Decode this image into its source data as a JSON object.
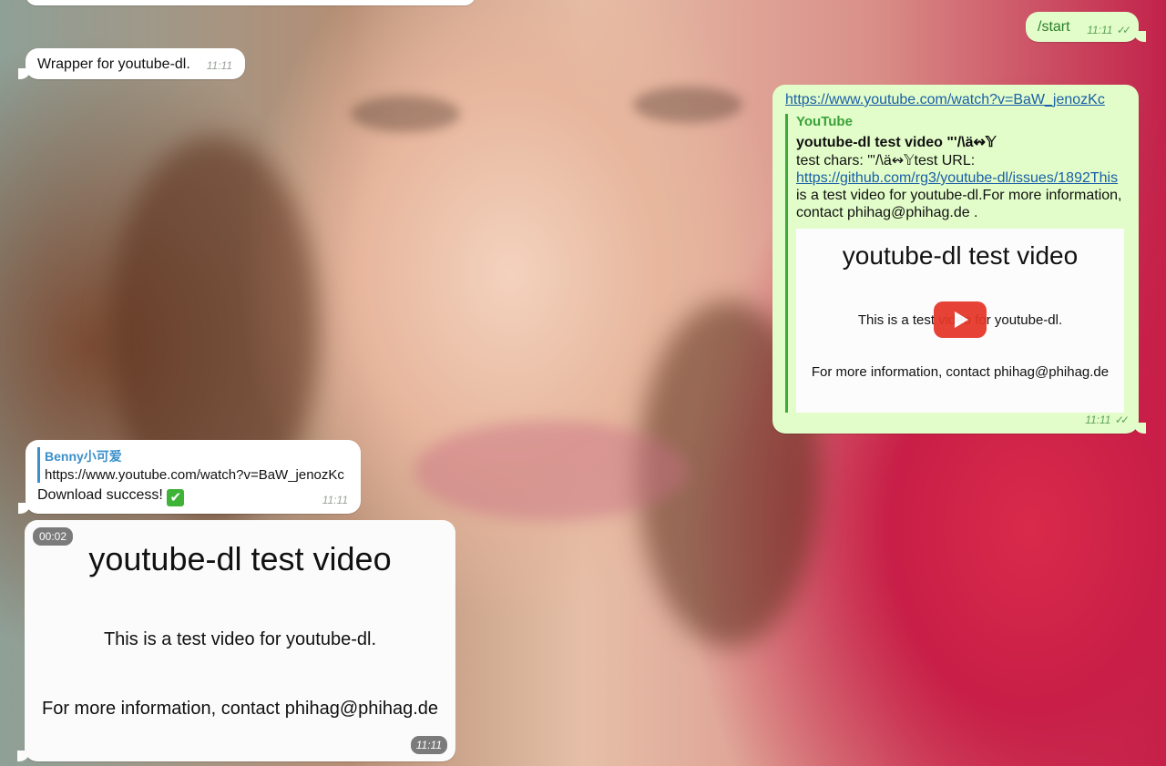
{
  "messages": {
    "wrapper": {
      "text": "Wrapper for youtube-dl.",
      "time": "11:11"
    },
    "start": {
      "text": "/start",
      "time": "11:11",
      "status": "✓✓"
    },
    "link_preview": {
      "url": "https://www.youtube.com/watch?v=BaW_jenozKc",
      "source": "YouTube",
      "title": "youtube-dl test video \"'/\\ä↭𝕐",
      "desc_prefix": "test chars:  \"'/\\ä↭𝕐test URL: ",
      "desc_link": "https://github.com/rg3/youtube-dl/issues/1892This",
      "desc_suffix": " is a test video for youtube-dl.For more information, contact phihag@phihag.de .",
      "preview_title": "youtube-dl test video",
      "preview_line1": "This is a test video for youtube-dl.",
      "preview_line2": "For more information, contact phihag@phihag.de",
      "time": "11:11",
      "status": "✓✓"
    },
    "reply": {
      "reply_to_name": "Benny小可爱",
      "reply_to_text": "https://www.youtube.com/watch?v=BaW_jenozKc",
      "text": "Download success!",
      "emoji": "✔",
      "time": "11:11"
    },
    "video": {
      "duration": "00:02",
      "title": "youtube-dl test video",
      "line1": "This is a test video for youtube-dl.",
      "line2": "For more information, contact phihag@phihag.de",
      "time": "11:11"
    }
  },
  "colors": {
    "outgoing_bubble": "#e2fdc9",
    "incoming_bubble": "#ffffff",
    "link": "#1a5fa8",
    "play_button": "#e53528",
    "reply_accent": "#3a8fc9",
    "quote_accent": "#3cab3c"
  }
}
